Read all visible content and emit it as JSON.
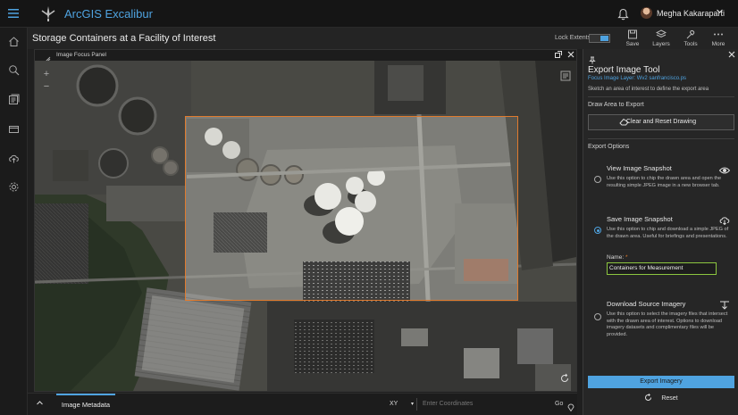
{
  "header": {
    "app_title": "ArcGIS Excalibur",
    "user_name": "Megha Kakaraparti",
    "icons": [
      "menu-icon",
      "excalibur-logo-icon",
      "bell-icon",
      "avatar",
      "chevron-down-icon"
    ]
  },
  "rail": {
    "items": [
      "home-icon",
      "search-icon",
      "library-icon",
      "folder-icon",
      "upload-icon",
      "settings-icon"
    ]
  },
  "titlebar": {
    "page_title": "Storage Containers at a Facility of Interest",
    "lock_extents_label": "Lock Extents",
    "lock_extents_on": true,
    "tools": [
      {
        "label": "Save",
        "icon": "save-icon"
      },
      {
        "label": "Layers",
        "icon": "layers-icon"
      },
      {
        "label": "Tools",
        "icon": "tools-icon"
      },
      {
        "label": "More",
        "icon": "more-icon"
      }
    ]
  },
  "map_panel": {
    "title": "Image Focus Panel",
    "zoom_in": "+",
    "zoom_out": "−",
    "accent": "#e07b2e"
  },
  "bottom_bar": {
    "tab_label": "Image Metadata",
    "coord_system": "XY",
    "coord_placeholder": "Enter Coordinates",
    "go_label": "Go"
  },
  "export_panel": {
    "title": "Export Image Tool",
    "focus_layer": "Focus Image Layer: Wv2 sanfrancisco.ps",
    "hint": "Sketch an area of interest to define the export area",
    "draw_section": "Draw Area to Export",
    "clear_button": "Clear and Reset Drawing",
    "options_section": "Export Options",
    "options": [
      {
        "title": "View Image Snapshot",
        "desc": "Use this option to chip the drawn area and open the resulting simple JPEG image in a new browser tab.",
        "selected": false,
        "icon": "eye-icon"
      },
      {
        "title": "Save Image Snapshot",
        "desc": "Use this option to chip and download a simple JPEG of the drawn area. Useful for briefings and presentations.",
        "selected": true,
        "icon": "cloud-download-icon"
      },
      {
        "title": "Download Source Imagery",
        "desc": "Use this option to select the imagery files that intersect with the drawn area of interest. Options to download imagery datasets and complimentary files will be provided.",
        "selected": false,
        "icon": "download-icon"
      }
    ],
    "name_label": "Name:",
    "name_required": "*",
    "name_value": "Containers for Measurement",
    "export_button": "Export Imagery",
    "reset_button": "Reset",
    "accent": "#4fa3e0"
  }
}
